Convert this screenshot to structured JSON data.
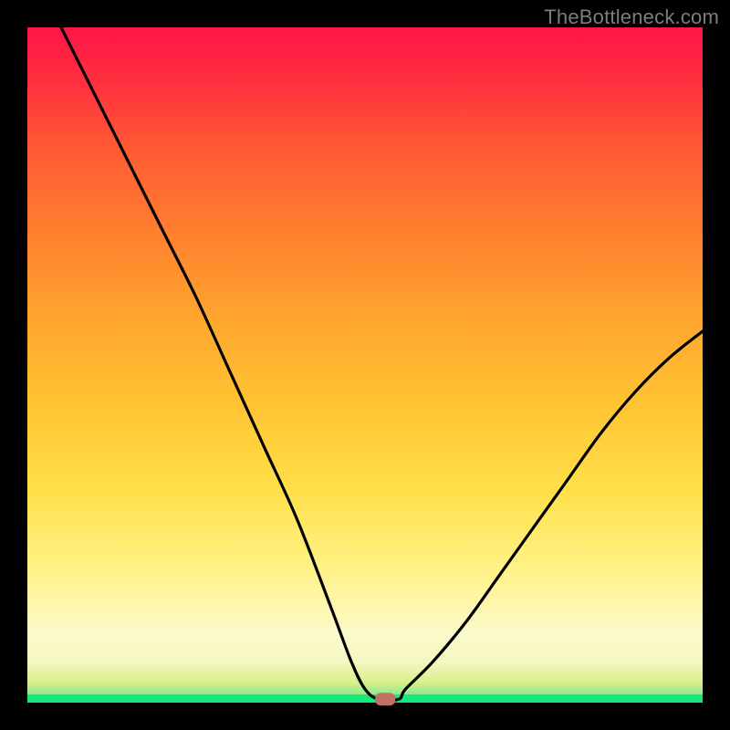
{
  "watermark": "TheBottleneck.com",
  "chart_data": {
    "type": "line",
    "title": "",
    "xlabel": "",
    "ylabel": "",
    "xlim": [
      0,
      100
    ],
    "ylim": [
      0,
      100
    ],
    "grid": false,
    "legend": false,
    "series": [
      {
        "name": "bottleneck-curve",
        "x": [
          5,
          10,
          15,
          20,
          25,
          30,
          35,
          40,
          45,
          48,
          50,
          52,
          55,
          56,
          60,
          65,
          70,
          75,
          80,
          85,
          90,
          95,
          100
        ],
        "y": [
          100,
          90,
          80,
          70,
          60,
          49,
          38,
          27,
          14,
          6,
          2,
          0.5,
          0.5,
          2,
          6,
          12,
          19,
          26,
          33,
          40,
          46,
          51,
          55
        ],
        "note": "V-shaped curve. Left branch descends steeply from top-left; minimum around x≈53; right branch rises with decreasing slope to roughly half-height at the right edge."
      }
    ],
    "marker": {
      "x": 53,
      "y": 0.5,
      "shape": "rounded-rect",
      "color": "#c17066",
      "note": "Small rounded marker sitting at the curve minimum on the green strip."
    },
    "background_gradient": {
      "bottom": "#17e87a",
      "mid": "#ffe648",
      "top": "#ff1547"
    }
  }
}
